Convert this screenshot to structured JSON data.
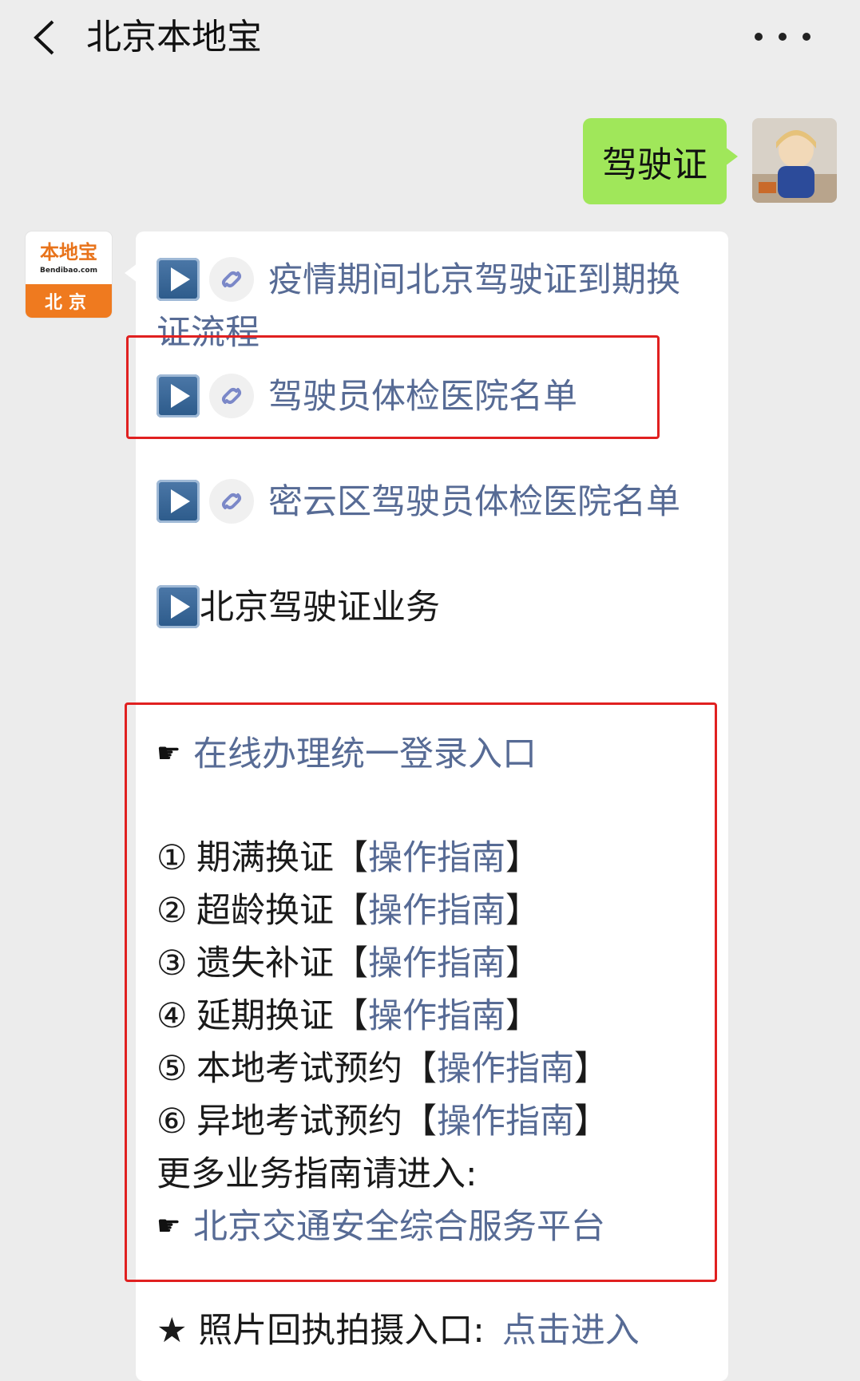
{
  "header": {
    "title": "北京本地宝"
  },
  "user_message": {
    "text": "驾驶证"
  },
  "bot": {
    "avatar_brand": "本地宝",
    "avatar_site": "Bendibao.com",
    "avatar_city": "北京",
    "links": [
      {
        "line1": "疫情期间北京驾驶证到期换",
        "line2": "证流程"
      },
      {
        "text": "驾驶员体检医院名单"
      },
      {
        "text": "密云区驾驶员体检医院名单"
      }
    ],
    "section_title": "北京驾驶证业务",
    "online_login": "在线办理统一登录入口",
    "items": [
      {
        "num": "①",
        "label": "期满换证",
        "guide": "操作指南"
      },
      {
        "num": "②",
        "label": "超龄换证",
        "guide": "操作指南"
      },
      {
        "num": "③",
        "label": "遗失补证",
        "guide": "操作指南"
      },
      {
        "num": "④",
        "label": "延期换证",
        "guide": "操作指南"
      },
      {
        "num": "⑤",
        "label": "本地考试预约",
        "guide": "操作指南"
      },
      {
        "num": "⑥",
        "label": "异地考试预约",
        "guide": "操作指南"
      }
    ],
    "bracket_open": "【",
    "bracket_close": "】",
    "more_text": "更多业务指南请进入:",
    "platform_link": "北京交通安全综合服务平台",
    "photo_label": "★ 照片回执拍摄入口:",
    "photo_link": "点击进入"
  },
  "colors": {
    "link": "#576b95",
    "bubble_green": "#a0e75a",
    "highlight_red": "#e02020"
  }
}
